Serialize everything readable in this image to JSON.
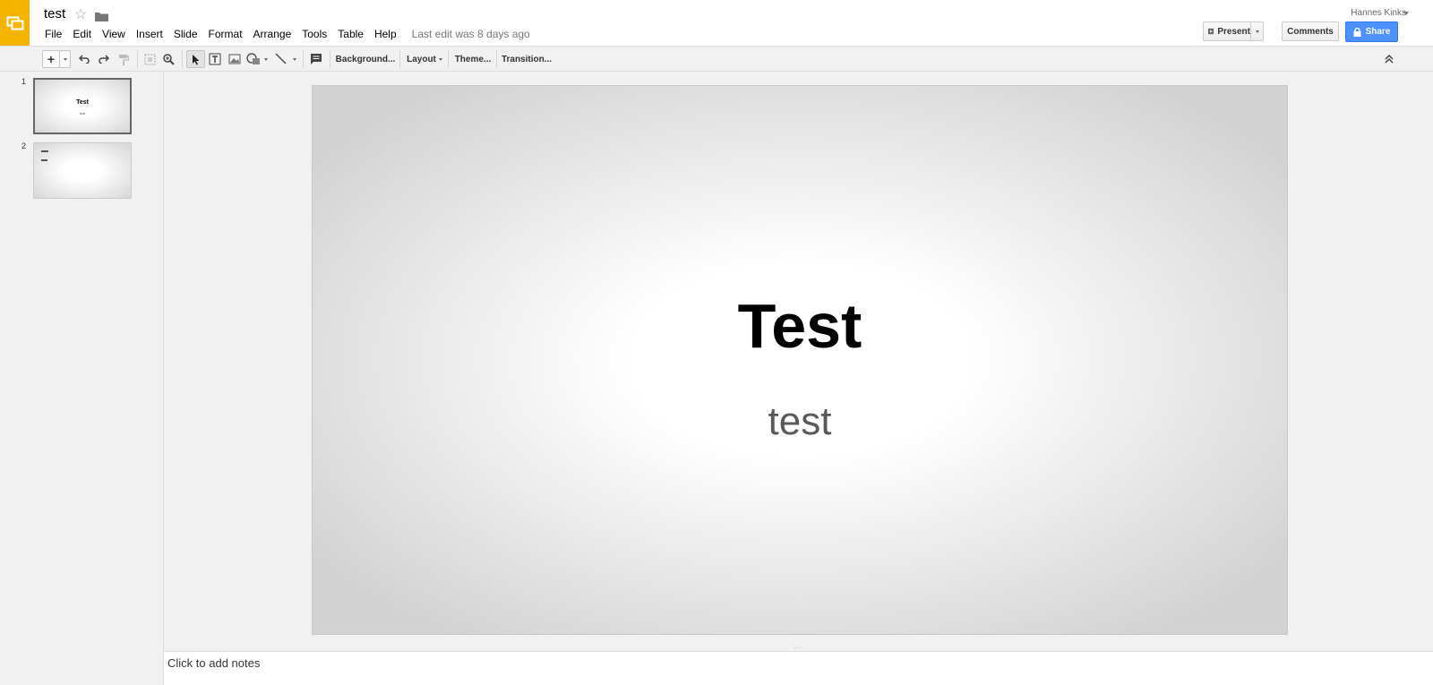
{
  "app": {
    "doc_title": "test",
    "last_edit": "Last edit was 8 days ago"
  },
  "menu": [
    "File",
    "Edit",
    "View",
    "Insert",
    "Slide",
    "Format",
    "Arrange",
    "Tools",
    "Table",
    "Help"
  ],
  "account": {
    "user_name": "Hannes Kinks"
  },
  "buttons": {
    "present": "Present",
    "comments": "Comments",
    "share": "Share"
  },
  "toolbar": {
    "background": "Background...",
    "layout": "Layout",
    "theme": "Theme...",
    "transition": "Transition..."
  },
  "filmstrip": [
    {
      "number": "1",
      "title": "Test",
      "subtitle": "test",
      "selected": true
    },
    {
      "number": "2",
      "selected": false
    }
  ],
  "slide": {
    "title": "Test",
    "subtitle": "test"
  },
  "notes": {
    "placeholder": "Click to add notes"
  },
  "colors": {
    "brand": "#f4b400",
    "share": "#4d90fe"
  }
}
